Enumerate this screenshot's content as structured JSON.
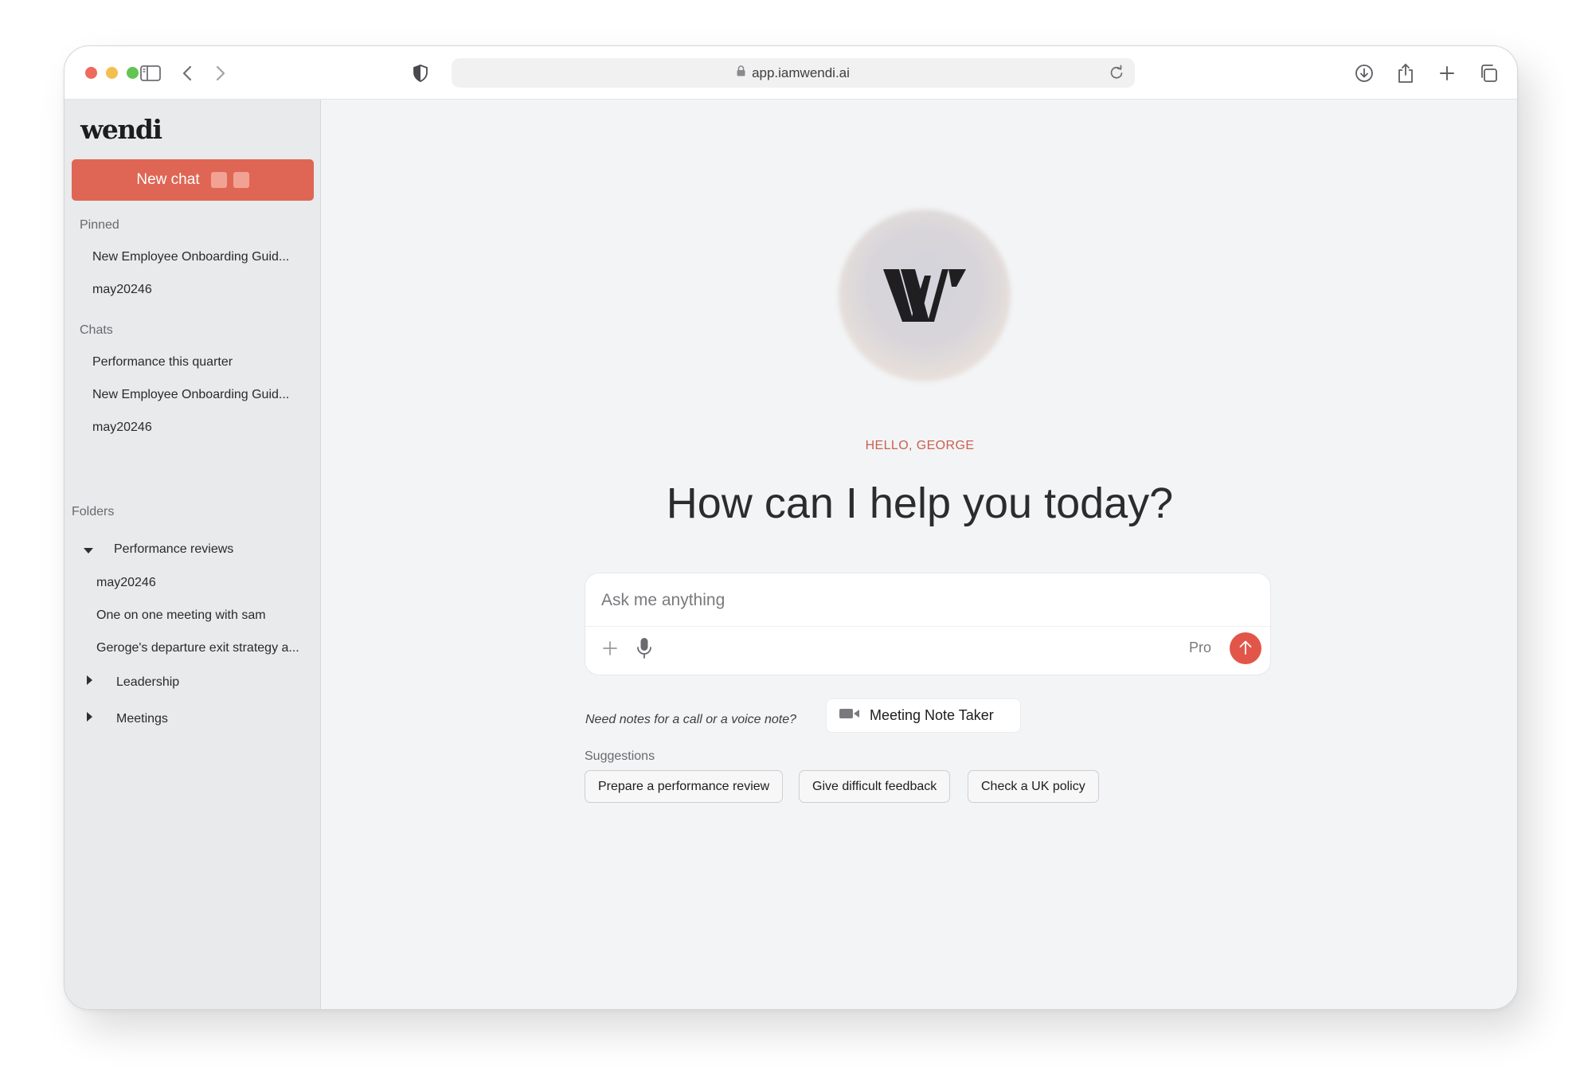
{
  "browser": {
    "url": "app.iamwendi.ai",
    "icons": [
      "sidebar-toggle-icon",
      "back-arrow-icon",
      "forward-arrow-icon",
      "shield-icon",
      "lock-icon",
      "reload-icon",
      "download-icon",
      "share-icon",
      "new-tab-plus-icon",
      "tabs-overview-icon"
    ]
  },
  "sidebar": {
    "logo": "wendi",
    "new_chat_label": "New chat",
    "pinned_title": "Pinned",
    "pinned": [
      "New Employee Onboarding Guid...",
      "may20246"
    ],
    "chats_title": "Chats",
    "chats": [
      "Performance this quarter",
      "New Employee Onboarding Guid...",
      "may20246"
    ],
    "folders_title": "Folders",
    "folders": [
      {
        "name": "Performance reviews",
        "expanded": true,
        "items": [
          "may20246",
          "One on one meeting with sam",
          "Geroge's departure exit strategy a..."
        ]
      },
      {
        "name": "Leadership",
        "expanded": false
      },
      {
        "name": "Meetings",
        "expanded": false
      }
    ]
  },
  "main": {
    "greeting": "HELLO, GEORGE",
    "headline": "How can I help you today?",
    "composer": {
      "placeholder": "Ask me anything",
      "mode_label": "Pro"
    },
    "note_prompt": "Need notes for a call or a voice note?",
    "meeting_note_taker_label": "Meeting Note Taker",
    "suggestions_title": "Suggestions",
    "suggestions": [
      "Prepare a performance review",
      "Give difficult feedback",
      "Check a UK policy"
    ]
  },
  "colors": {
    "accent": "#df6654",
    "send_button": "#e2564a",
    "greeting": "#c9604f",
    "sidebar_bg": "#e9eaec",
    "main_bg": "#f3f4f6"
  }
}
